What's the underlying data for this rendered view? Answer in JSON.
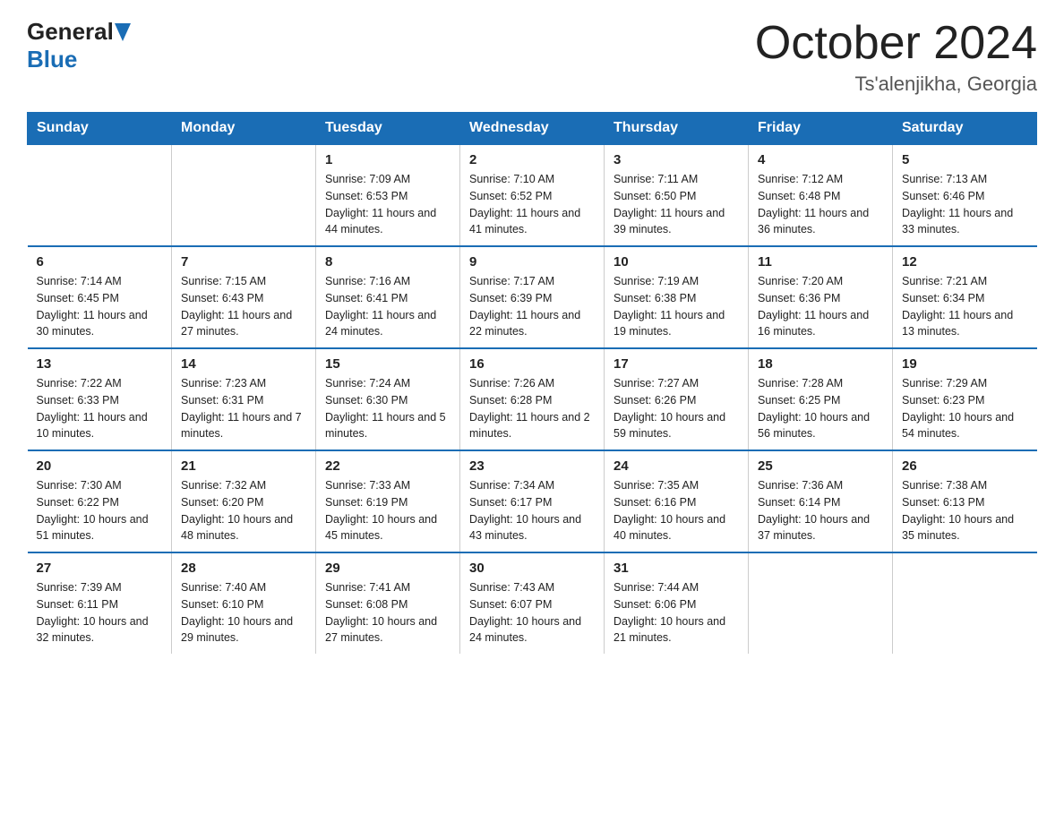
{
  "header": {
    "month_title": "October 2024",
    "location": "Ts'alenjikha, Georgia",
    "logo_general": "General",
    "logo_blue": "Blue"
  },
  "days_of_week": [
    "Sunday",
    "Monday",
    "Tuesday",
    "Wednesday",
    "Thursday",
    "Friday",
    "Saturday"
  ],
  "weeks": [
    [
      {
        "day": "",
        "info": ""
      },
      {
        "day": "",
        "info": ""
      },
      {
        "day": "1",
        "info": "Sunrise: 7:09 AM\nSunset: 6:53 PM\nDaylight: 11 hours\nand 44 minutes."
      },
      {
        "day": "2",
        "info": "Sunrise: 7:10 AM\nSunset: 6:52 PM\nDaylight: 11 hours\nand 41 minutes."
      },
      {
        "day": "3",
        "info": "Sunrise: 7:11 AM\nSunset: 6:50 PM\nDaylight: 11 hours\nand 39 minutes."
      },
      {
        "day": "4",
        "info": "Sunrise: 7:12 AM\nSunset: 6:48 PM\nDaylight: 11 hours\nand 36 minutes."
      },
      {
        "day": "5",
        "info": "Sunrise: 7:13 AM\nSunset: 6:46 PM\nDaylight: 11 hours\nand 33 minutes."
      }
    ],
    [
      {
        "day": "6",
        "info": "Sunrise: 7:14 AM\nSunset: 6:45 PM\nDaylight: 11 hours\nand 30 minutes."
      },
      {
        "day": "7",
        "info": "Sunrise: 7:15 AM\nSunset: 6:43 PM\nDaylight: 11 hours\nand 27 minutes."
      },
      {
        "day": "8",
        "info": "Sunrise: 7:16 AM\nSunset: 6:41 PM\nDaylight: 11 hours\nand 24 minutes."
      },
      {
        "day": "9",
        "info": "Sunrise: 7:17 AM\nSunset: 6:39 PM\nDaylight: 11 hours\nand 22 minutes."
      },
      {
        "day": "10",
        "info": "Sunrise: 7:19 AM\nSunset: 6:38 PM\nDaylight: 11 hours\nand 19 minutes."
      },
      {
        "day": "11",
        "info": "Sunrise: 7:20 AM\nSunset: 6:36 PM\nDaylight: 11 hours\nand 16 minutes."
      },
      {
        "day": "12",
        "info": "Sunrise: 7:21 AM\nSunset: 6:34 PM\nDaylight: 11 hours\nand 13 minutes."
      }
    ],
    [
      {
        "day": "13",
        "info": "Sunrise: 7:22 AM\nSunset: 6:33 PM\nDaylight: 11 hours\nand 10 minutes."
      },
      {
        "day": "14",
        "info": "Sunrise: 7:23 AM\nSunset: 6:31 PM\nDaylight: 11 hours\nand 7 minutes."
      },
      {
        "day": "15",
        "info": "Sunrise: 7:24 AM\nSunset: 6:30 PM\nDaylight: 11 hours\nand 5 minutes."
      },
      {
        "day": "16",
        "info": "Sunrise: 7:26 AM\nSunset: 6:28 PM\nDaylight: 11 hours\nand 2 minutes."
      },
      {
        "day": "17",
        "info": "Sunrise: 7:27 AM\nSunset: 6:26 PM\nDaylight: 10 hours\nand 59 minutes."
      },
      {
        "day": "18",
        "info": "Sunrise: 7:28 AM\nSunset: 6:25 PM\nDaylight: 10 hours\nand 56 minutes."
      },
      {
        "day": "19",
        "info": "Sunrise: 7:29 AM\nSunset: 6:23 PM\nDaylight: 10 hours\nand 54 minutes."
      }
    ],
    [
      {
        "day": "20",
        "info": "Sunrise: 7:30 AM\nSunset: 6:22 PM\nDaylight: 10 hours\nand 51 minutes."
      },
      {
        "day": "21",
        "info": "Sunrise: 7:32 AM\nSunset: 6:20 PM\nDaylight: 10 hours\nand 48 minutes."
      },
      {
        "day": "22",
        "info": "Sunrise: 7:33 AM\nSunset: 6:19 PM\nDaylight: 10 hours\nand 45 minutes."
      },
      {
        "day": "23",
        "info": "Sunrise: 7:34 AM\nSunset: 6:17 PM\nDaylight: 10 hours\nand 43 minutes."
      },
      {
        "day": "24",
        "info": "Sunrise: 7:35 AM\nSunset: 6:16 PM\nDaylight: 10 hours\nand 40 minutes."
      },
      {
        "day": "25",
        "info": "Sunrise: 7:36 AM\nSunset: 6:14 PM\nDaylight: 10 hours\nand 37 minutes."
      },
      {
        "day": "26",
        "info": "Sunrise: 7:38 AM\nSunset: 6:13 PM\nDaylight: 10 hours\nand 35 minutes."
      }
    ],
    [
      {
        "day": "27",
        "info": "Sunrise: 7:39 AM\nSunset: 6:11 PM\nDaylight: 10 hours\nand 32 minutes."
      },
      {
        "day": "28",
        "info": "Sunrise: 7:40 AM\nSunset: 6:10 PM\nDaylight: 10 hours\nand 29 minutes."
      },
      {
        "day": "29",
        "info": "Sunrise: 7:41 AM\nSunset: 6:08 PM\nDaylight: 10 hours\nand 27 minutes."
      },
      {
        "day": "30",
        "info": "Sunrise: 7:43 AM\nSunset: 6:07 PM\nDaylight: 10 hours\nand 24 minutes."
      },
      {
        "day": "31",
        "info": "Sunrise: 7:44 AM\nSunset: 6:06 PM\nDaylight: 10 hours\nand 21 minutes."
      },
      {
        "day": "",
        "info": ""
      },
      {
        "day": "",
        "info": ""
      }
    ]
  ]
}
